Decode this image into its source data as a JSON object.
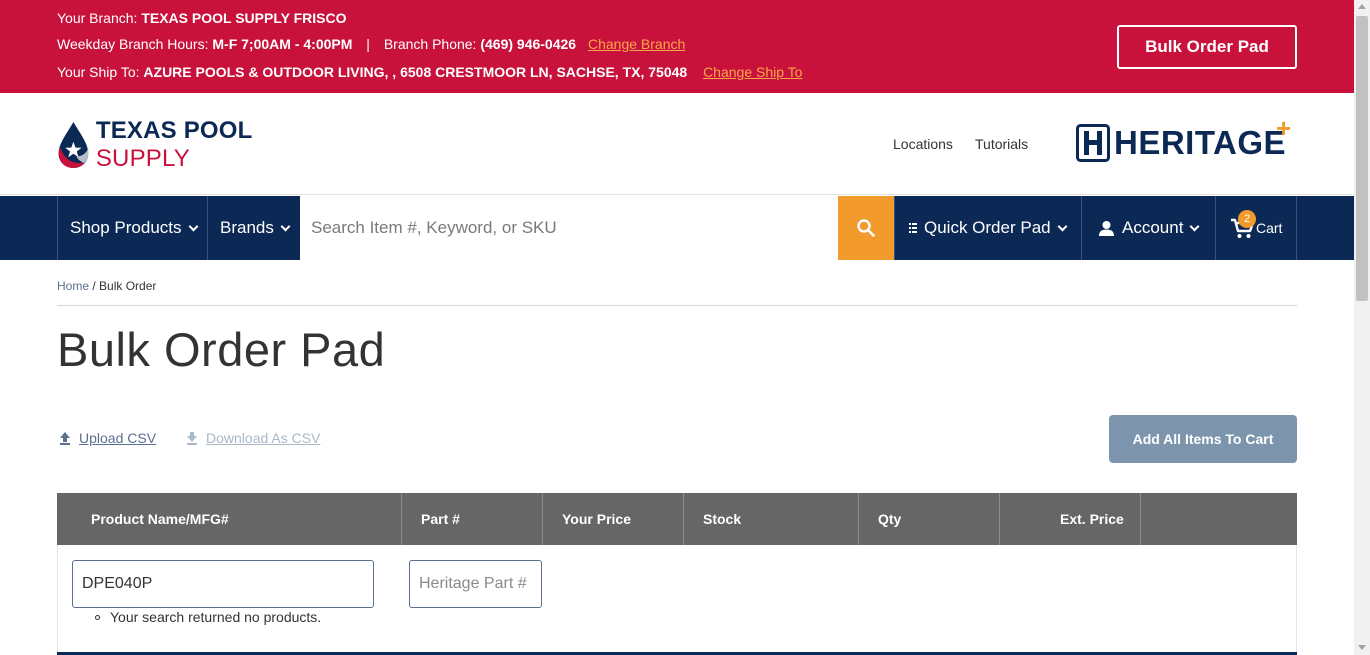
{
  "colors": {
    "brand_red": "#c8123c",
    "navy": "#0c2855",
    "orange": "#f39a2c",
    "table_header": "#666666",
    "button_disabled": "#7c95ad"
  },
  "branch_bar": {
    "branch_label": "Your Branch:",
    "branch_name": "TEXAS POOL SUPPLY FRISCO",
    "hours_label": "Weekday Branch Hours:",
    "hours_value": "M-F 7;00AM - 4:00PM",
    "separator": "|",
    "phone_label": "Branch Phone:",
    "phone_value": "(469) 946-0426",
    "change_branch": "Change Branch",
    "ship_label": "Your Ship To:",
    "ship_value": "AZURE POOLS & OUTDOOR LIVING, , 6508 CRESTMOOR LN, SACHSE, TX, 75048",
    "change_ship": "Change Ship To",
    "bulk_button": "Bulk Order Pad"
  },
  "header": {
    "logo_word1": "TEXAS POOL",
    "logo_word2": "SUPPLY",
    "links": [
      "Locations",
      "Tutorials"
    ],
    "partner_logo": "HERITAGE"
  },
  "nav": {
    "shop_products": "Shop Products",
    "brands": "Brands",
    "search_placeholder": "Search Item #, Keyword, or SKU",
    "quick_order": "Quick Order Pad",
    "account": "Account",
    "cart": "Cart",
    "cart_count": "2",
    "icons": {
      "search": "search-icon",
      "quick_order": "list-icon",
      "account": "user-icon",
      "cart": "cart-icon"
    }
  },
  "breadcrumb": {
    "home": "Home",
    "separator": "/",
    "current": "Bulk Order"
  },
  "page_title": "Bulk Order Pad",
  "actions": {
    "upload": "Upload CSV",
    "download": "Download As CSV",
    "add_all": "Add All Items To Cart"
  },
  "table": {
    "headers": [
      "Product Name/MFG#",
      "Part #",
      "Your Price",
      "Stock",
      "Qty",
      "Ext. Price"
    ],
    "rows": [
      {
        "product_value": "DPE040P",
        "part_placeholder": "Heritage Part #",
        "error": "Your search returned no products."
      }
    ]
  }
}
